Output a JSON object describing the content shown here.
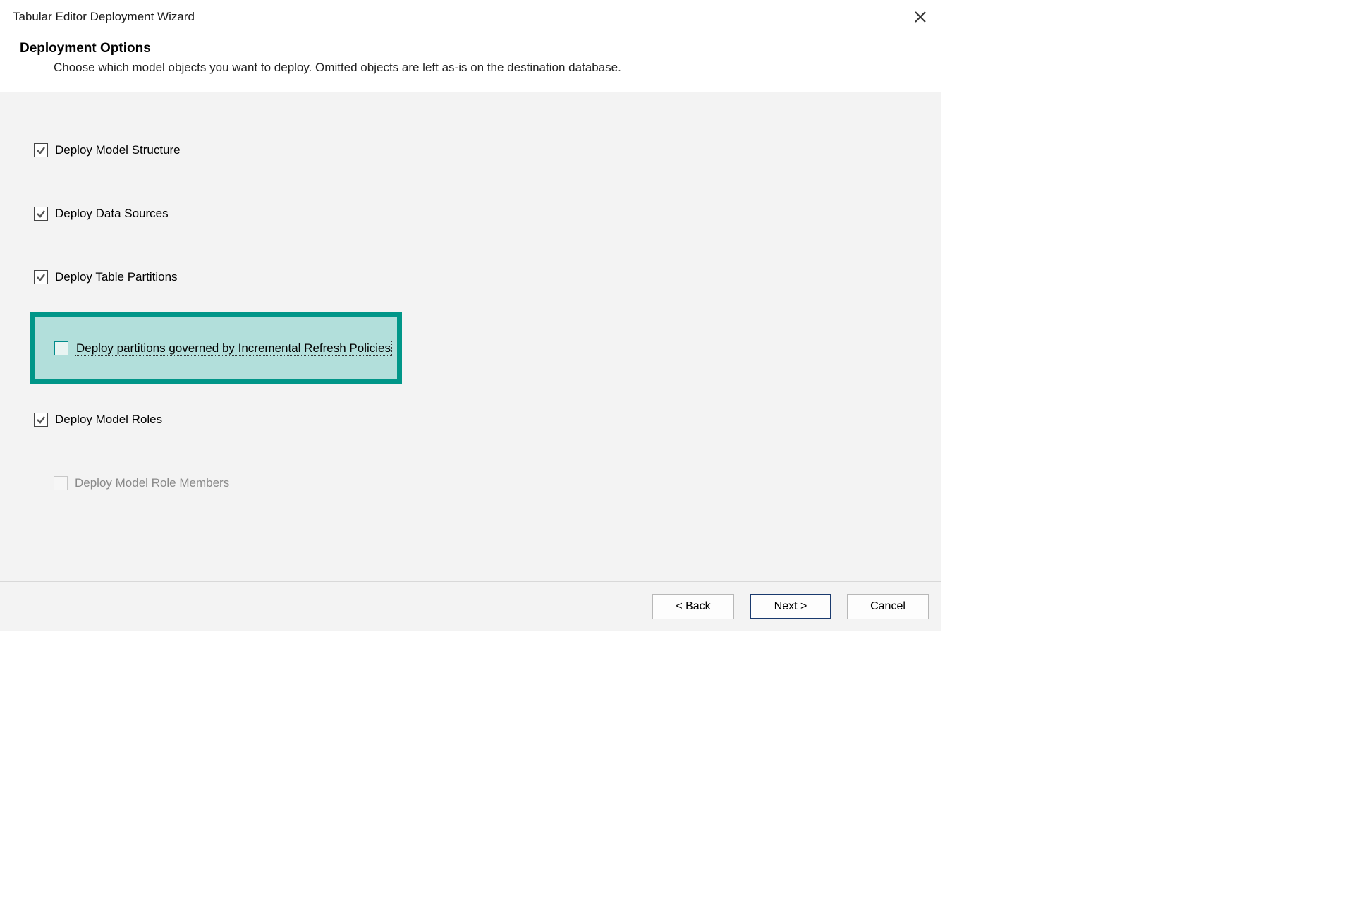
{
  "titlebar": {
    "title": "Tabular Editor Deployment Wizard"
  },
  "header": {
    "title": "Deployment Options",
    "subtitle": "Choose which model objects you want to deploy. Omitted objects are left as-is on the destination database."
  },
  "options": {
    "model_structure": {
      "label": "Deploy Model Structure",
      "checked": true,
      "enabled": true
    },
    "data_sources": {
      "label": "Deploy Data Sources",
      "checked": true,
      "enabled": true
    },
    "table_partitions": {
      "label": "Deploy Table Partitions",
      "checked": true,
      "enabled": true
    },
    "incremental_refresh": {
      "label": "Deploy partitions governed by Incremental Refresh Policies",
      "checked": false,
      "enabled": true,
      "highlighted": true,
      "focused": true
    },
    "model_roles": {
      "label": "Deploy Model Roles",
      "checked": true,
      "enabled": true
    },
    "role_members": {
      "label": "Deploy Model Role Members",
      "checked": false,
      "enabled": false
    }
  },
  "footer": {
    "back_label": "< Back",
    "next_label": "Next >",
    "cancel_label": "Cancel"
  }
}
